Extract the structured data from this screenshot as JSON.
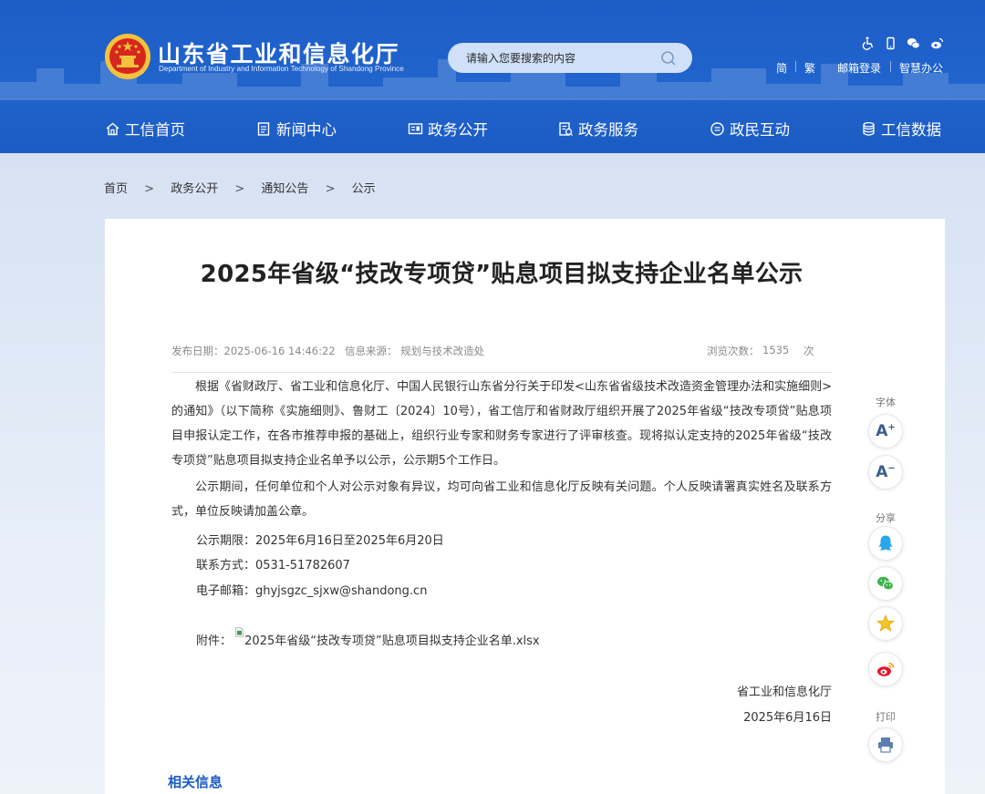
{
  "header": {
    "title": "山东省工业和信息化厅",
    "subtitle": "Department of Industry and Information Technology of Shandong Province",
    "search_placeholder": "请输入您要搜索的内容",
    "links": {
      "simplified": "简",
      "traditional": "繁",
      "mail_login": "邮箱登录",
      "smart_office": "智慧办公"
    },
    "tool_icons": [
      "accessibility-icon",
      "mobile-icon",
      "wechat-icon",
      "weibo-icon"
    ]
  },
  "nav": [
    {
      "label": "工信首页",
      "icon": "home-icon"
    },
    {
      "label": "新闻中心",
      "icon": "news-icon"
    },
    {
      "label": "政务公开",
      "icon": "open-gov-icon"
    },
    {
      "label": "政务服务",
      "icon": "service-icon"
    },
    {
      "label": "政民互动",
      "icon": "chat-icon"
    },
    {
      "label": "工信数据",
      "icon": "database-icon"
    }
  ],
  "breadcrumb": {
    "items": [
      "首页",
      "政务公开",
      "通知公告",
      "公示"
    ],
    "separator": ">"
  },
  "article": {
    "title": "2025年省级“技改专项贷”贴息项目拟支持企业名单公示",
    "publish_date": "发布日期：2025-06-16 14:46:22",
    "source": "信息来源：  规划与技术改造处",
    "views_label": "浏览次数：",
    "views": "1535",
    "views_unit": "次",
    "paragraphs": [
      "根据《省财政厅、省工业和信息化厅、中国人民银行山东省分行关于印发<山东省省级技术改造资金管理办法和实施细则>的通知》（以下简称《实施细则》、鲁财工〔2024〕10号），省工信厅和省财政厅组织开展了2025年省级“技改专项贷”贴息项目申报认定工作，在各市推荐申报的基础上，组织行业专家和财务专家进行了评审核查。现将拟认定支持的2025年省级“技改专项贷”贴息项目拟支持企业名单予以公示，公示期5个工作日。",
      "公示期间，任何单位和个人对公示对象有异议，均可向省工业和信息化厅反映有关问题。个人反映请署真实姓名及联系方式，单位反映请加盖公章。"
    ],
    "period": "公示期限：2025年6月16日至2025年6月20日",
    "contact": "联系方式：0531-51782607",
    "email": "电子邮箱：ghyjsgzc_sjxw@shandong.cn",
    "attachment_label": "附件：",
    "attachment_name": "2025年省级“技改专项贷”贴息项目拟支持企业名单.xlsx",
    "signature_org": "省工业和信息化厅",
    "signature_date": "2025年6月16日"
  },
  "related_title": "相关信息",
  "side_tools": {
    "font_label": "字体",
    "font_increase": "A",
    "font_increase_sup": "+",
    "font_decrease": "A",
    "font_decrease_sup": "−",
    "share_label": "分享",
    "share_targets": [
      "qq-icon",
      "wechat-icon",
      "qzone-icon",
      "weibo-icon"
    ],
    "print_label": "打印"
  },
  "colors": {
    "header_blue": "#1e5cc8",
    "search_bg": "#cfe0f8",
    "link_blue": "#1d5bc2",
    "page_bg": "#dde7f5"
  }
}
